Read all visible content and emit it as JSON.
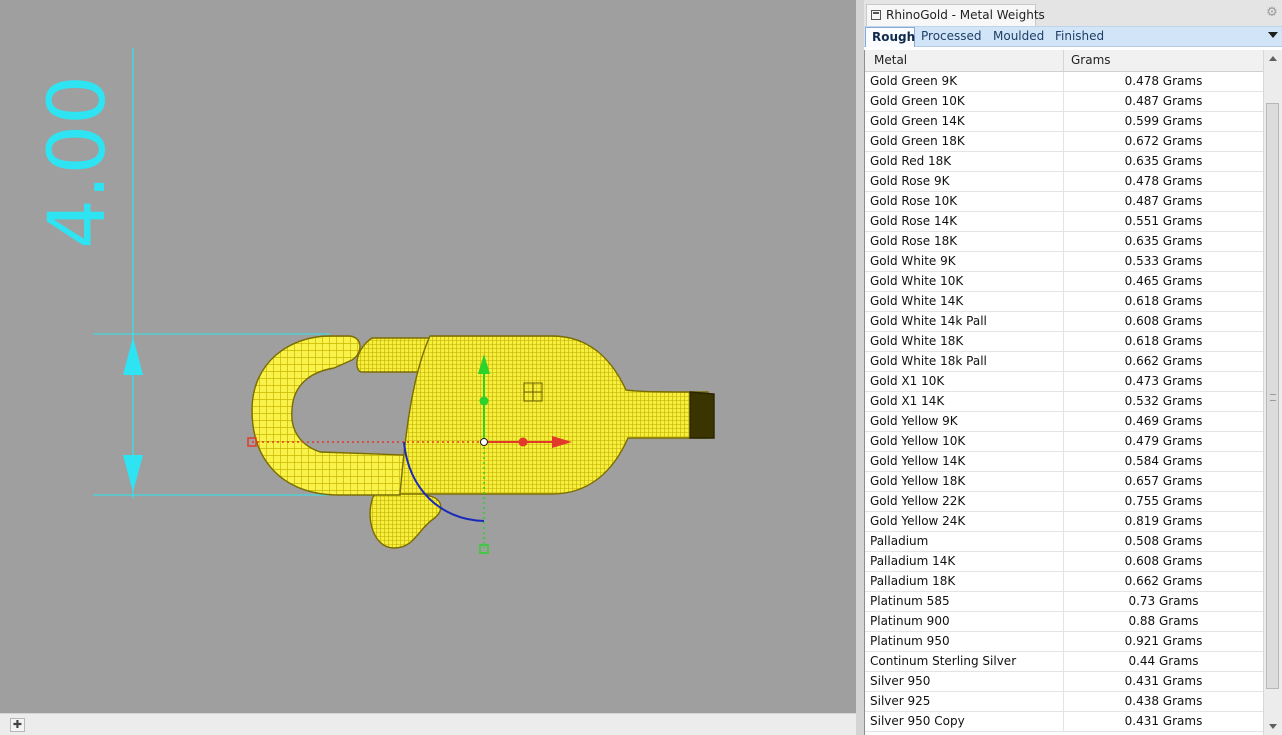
{
  "viewport": {
    "dimension_value": "4.00",
    "colors": {
      "background": "#9f9f9f",
      "dimension": "#2fe4f2",
      "object": "#f7f23a",
      "x_axis": "#e23a2a",
      "y_axis": "#2cd22c",
      "rotation": "#1a2ab8"
    }
  },
  "bottom_bar": {
    "add_viewport_icon": "plus-icon"
  },
  "panel": {
    "title": "RhinoGold - Metal Weights",
    "settings_icon": "gear-icon",
    "tabs": [
      {
        "label": "Rough",
        "active": true
      },
      {
        "label": "Processed",
        "active": false
      },
      {
        "label": "Moulded",
        "active": false
      },
      {
        "label": "Finished",
        "active": false
      }
    ],
    "table": {
      "headers": {
        "metal": "Metal",
        "grams": "Grams"
      },
      "rows": [
        {
          "metal": "Gold Green 9K",
          "grams": "0.478 Grams"
        },
        {
          "metal": "Gold Green 10K",
          "grams": "0.487 Grams"
        },
        {
          "metal": "Gold Green 14K",
          "grams": "0.599 Grams"
        },
        {
          "metal": "Gold Green 18K",
          "grams": "0.672 Grams"
        },
        {
          "metal": "Gold Red 18K",
          "grams": "0.635 Grams"
        },
        {
          "metal": "Gold Rose 9K",
          "grams": "0.478 Grams"
        },
        {
          "metal": "Gold Rose 10K",
          "grams": "0.487 Grams"
        },
        {
          "metal": "Gold Rose 14K",
          "grams": "0.551 Grams"
        },
        {
          "metal": "Gold Rose 18K",
          "grams": "0.635 Grams"
        },
        {
          "metal": "Gold White 9K",
          "grams": "0.533 Grams"
        },
        {
          "metal": "Gold White 10K",
          "grams": "0.465 Grams"
        },
        {
          "metal": "Gold White 14K",
          "grams": "0.618 Grams"
        },
        {
          "metal": "Gold White 14k Pall",
          "grams": "0.608 Grams"
        },
        {
          "metal": "Gold White 18K",
          "grams": "0.618 Grams"
        },
        {
          "metal": "Gold White 18k Pall",
          "grams": "0.662 Grams"
        },
        {
          "metal": "Gold X1 10K",
          "grams": "0.473 Grams"
        },
        {
          "metal": "Gold X1 14K",
          "grams": "0.532 Grams"
        },
        {
          "metal": "Gold Yellow 9K",
          "grams": "0.469 Grams"
        },
        {
          "metal": "Gold Yellow 10K",
          "grams": "0.479 Grams"
        },
        {
          "metal": "Gold Yellow 14K",
          "grams": "0.584 Grams"
        },
        {
          "metal": "Gold Yellow 18K",
          "grams": "0.657 Grams"
        },
        {
          "metal": "Gold Yellow 22K",
          "grams": "0.755 Grams"
        },
        {
          "metal": "Gold Yellow 24K",
          "grams": "0.819 Grams"
        },
        {
          "metal": "Palladium",
          "grams": "0.508 Grams"
        },
        {
          "metal": "Palladium 14K",
          "grams": "0.608 Grams"
        },
        {
          "metal": "Palladium 18K",
          "grams": "0.662 Grams"
        },
        {
          "metal": "Platinum 585",
          "grams": "0.73 Grams"
        },
        {
          "metal": "Platinum 900",
          "grams": "0.88 Grams"
        },
        {
          "metal": "Platinum 950",
          "grams": "0.921 Grams"
        },
        {
          "metal": "Continum Sterling Silver",
          "grams": "0.44 Grams"
        },
        {
          "metal": "Silver 950",
          "grams": "0.431 Grams"
        },
        {
          "metal": "Silver 925",
          "grams": "0.438 Grams"
        },
        {
          "metal": "Silver 950 Copy",
          "grams": "0.431 Grams"
        }
      ]
    }
  }
}
